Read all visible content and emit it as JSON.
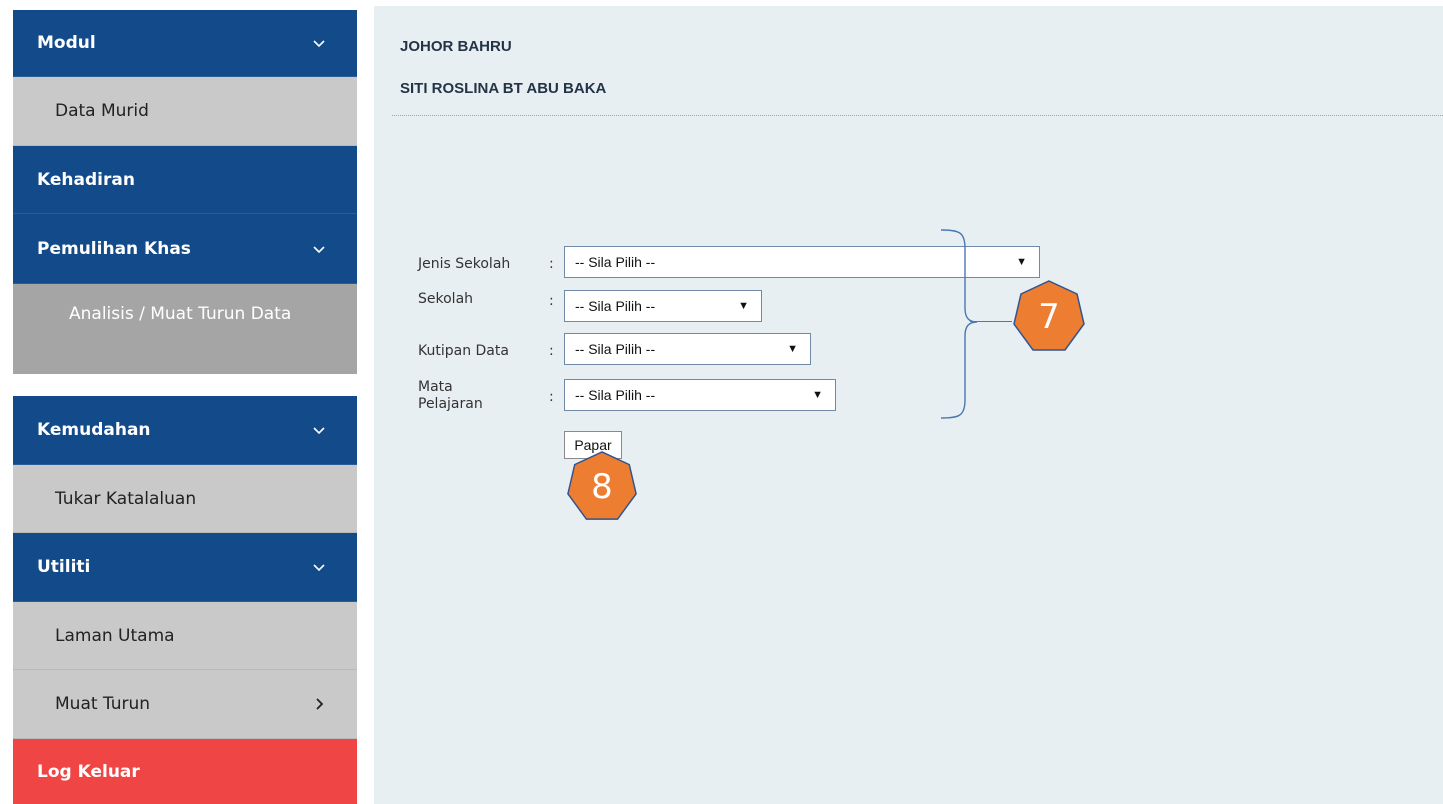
{
  "sidebar": {
    "items": [
      {
        "label": "Modul"
      },
      {
        "label": "Data Murid"
      },
      {
        "label": "Kehadiran"
      },
      {
        "label": "Pemulihan Khas"
      },
      {
        "label": "Analisis / Muat Turun Data"
      },
      {
        "label": "Kemudahan"
      },
      {
        "label": "Tukar Katalaluan"
      },
      {
        "label": "Utiliti"
      },
      {
        "label": "Laman Utama"
      },
      {
        "label": "Muat Turun"
      },
      {
        "label": "Log Keluar"
      }
    ]
  },
  "header": {
    "district": "JOHOR BAHRU",
    "user": "SITI ROSLINA BT ABU BAKA"
  },
  "form": {
    "jenis_sekolah": {
      "label": "Jenis Sekolah",
      "colon": ":",
      "value": "-- Sila Pilih --"
    },
    "sekolah": {
      "label": "Sekolah",
      "colon": ":",
      "value": "-- Sila Pilih --"
    },
    "kutipan_data": {
      "label": "Kutipan Data",
      "colon": ":",
      "value": "-- Sila Pilih --"
    },
    "mata_pelajaran": {
      "label_line1": "Mata",
      "label_line2": "Pelajaran",
      "colon": ":",
      "value": "-- Sila Pilih --"
    },
    "submit_label": "Papar",
    "dropdown_arrow": "▼"
  },
  "annotations": {
    "callout_form": "7",
    "callout_button": "8",
    "callout_color": "#ed7d31"
  },
  "colors": {
    "sidebar_blue": "#124a8a",
    "sidebar_gray": "#c9c9c9",
    "logout_red": "#f04545",
    "main_bg": "#e8eff2"
  }
}
